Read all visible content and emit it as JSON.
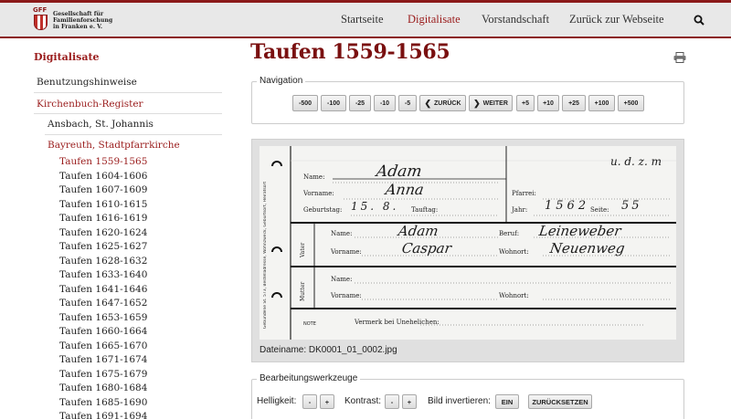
{
  "header": {
    "logo_abbr": "GFF",
    "logo_lines": [
      "Gesellschaft für",
      "Familienforschung",
      "in Franken e. V."
    ],
    "nav": [
      {
        "label": "Startseite",
        "active": false
      },
      {
        "label": "Digitalisate",
        "active": true
      },
      {
        "label": "Vorstandschaft",
        "active": false
      },
      {
        "label": "Zurück zur Webseite",
        "active": false
      }
    ],
    "search_icon": "search-icon"
  },
  "sidebar": {
    "title": "Digitalisate",
    "items": [
      {
        "label": "Benutzungshinweise"
      },
      {
        "label": "Kirchenbuch-Register"
      },
      {
        "label": "Ansbach, St. Johannis"
      },
      {
        "label": "Bayreuth, Stadtpfarrkirche"
      }
    ],
    "sub_items": [
      "Taufen 1559-1565",
      "Taufen 1604-1606",
      "Taufen 1607-1609",
      "Taufen 1610-1615",
      "Taufen 1616-1619",
      "Taufen 1620-1624",
      "Taufen 1625-1627",
      "Taufen 1628-1632",
      "Taufen 1633-1640",
      "Taufen 1641-1646",
      "Taufen 1647-1652",
      "Taufen 1653-1659",
      "Taufen 1660-1664",
      "Taufen 1665-1670",
      "Taufen 1671-1674",
      "Taufen 1675-1679",
      "Taufen 1680-1684",
      "Taufen 1685-1690",
      "Taufen 1691-1694"
    ],
    "active_sub": 0
  },
  "main": {
    "title": "Taufen 1559-1565",
    "print_icon": "printer-icon",
    "navigation_legend": "Navigation",
    "nav_buttons": [
      "-500",
      "-100",
      "-25",
      "-10",
      "-5",
      "ZURÜCK",
      "WEITER",
      "+5",
      "+10",
      "+25",
      "+100",
      "+500"
    ],
    "filename": "Dateiname: DK0001_01_0002.jpg",
    "tools_legend": "Bearbeitungswerkzeuge",
    "brightness_label": "Helligkeit:",
    "contrast_label": "Kontrast:",
    "invert_label": "Bild invertieren:",
    "minus": "-",
    "plus": "+",
    "invert_button": "EIN",
    "reset_button": "ZURÜCKSETZEN"
  },
  "scan": {
    "side_text": "Gebundene St. 573, Bestelladresse, Wohnzweck, Geburtsort, Heiratsort",
    "top_right": "u. d. z. m",
    "labels": {
      "name": "Name:",
      "vorname": "Vorname:",
      "geburtstag": "Geburtstag:",
      "tauftag": "Tauftag:",
      "pfarrei": "Pfarrei:",
      "jahr": "Jahr:",
      "seite": "Seite:",
      "vater": "Vater",
      "mutter": "Mutter",
      "beruf": "Beruf:",
      "wohnort": "Wohnort:",
      "vermerk": "Vermerk bei Unehelichen:",
      "note": "NOTE"
    },
    "values": {
      "child_name": "Adam",
      "child_vorname": "Anna",
      "geburtstag": "15. 8.",
      "jahr": "1562",
      "seite": "55",
      "father_name": "Adam",
      "father_vorname": "Caspar",
      "father_beruf": "Leineweber",
      "father_wohnort": "Neuenweg"
    }
  }
}
